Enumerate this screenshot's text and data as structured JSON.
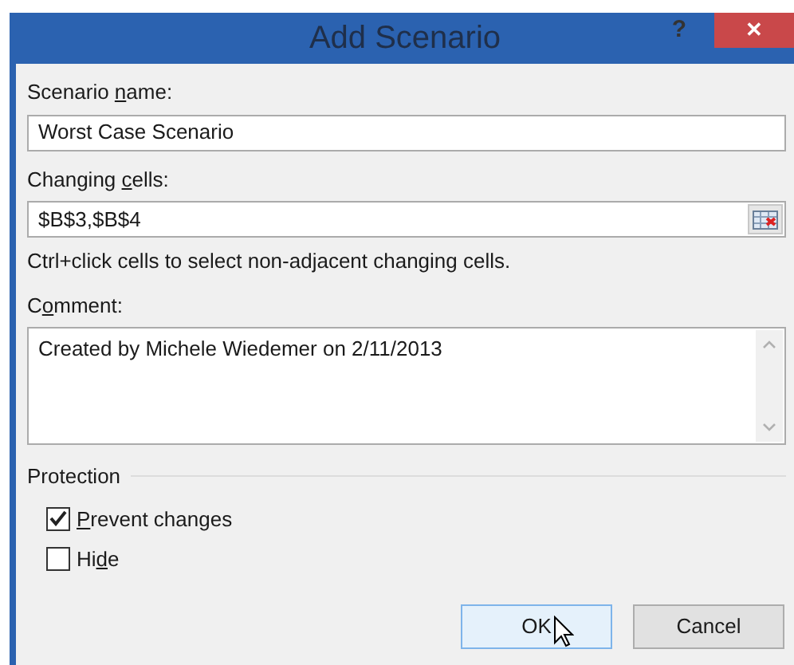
{
  "window": {
    "title": "Add Scenario",
    "help": "?",
    "close": "✕"
  },
  "fields": [
    {
      "kind": "text",
      "label": {
        "before": "Scenario ",
        "key": "n",
        "after": "ame:"
      },
      "value": "Worst Case Scenario"
    },
    {
      "kind": "reference",
      "label": {
        "before": "Changing ",
        "key": "c",
        "after": "ells:"
      },
      "value": "$B$3,$B$4",
      "hint": "Ctrl+click cells to select non-adjacent changing cells."
    },
    {
      "kind": "multiline",
      "label": {
        "before": "C",
        "key": "o",
        "after": "mment:"
      },
      "value": "Created by Michele Wiedemer on 2/11/2013"
    }
  ],
  "protection": {
    "title": "Protection",
    "options": [
      {
        "label": {
          "key": "P",
          "after": "revent changes"
        },
        "checked": true
      },
      {
        "label": {
          "before": "Hi",
          "key": "d",
          "after": "e"
        },
        "checked": false
      }
    ]
  },
  "buttons": [
    {
      "label": "OK",
      "default": true
    },
    {
      "label": "Cancel",
      "default": false
    }
  ]
}
